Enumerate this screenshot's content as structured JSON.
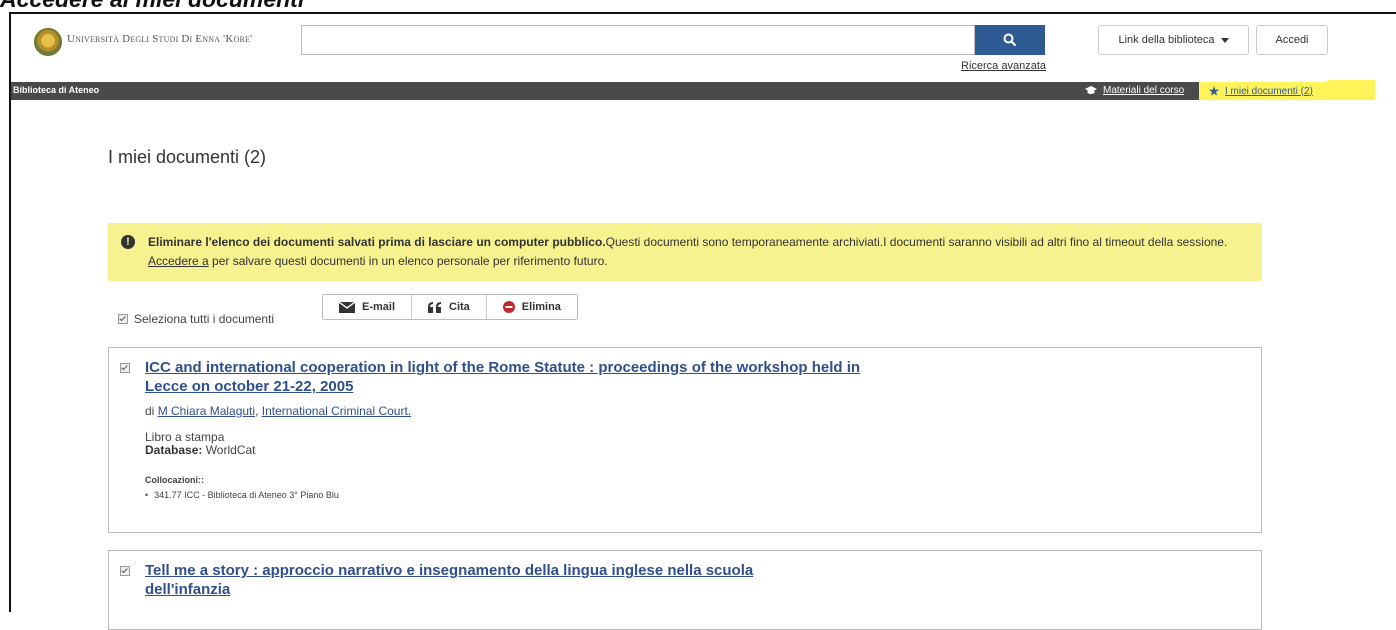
{
  "tutorial": {
    "heading": "Accedere ai miei documenti"
  },
  "header": {
    "logo_text": "Università Degli Studi Di Enna 'Kore'",
    "search_value": "",
    "advanced_search": "Ricerca avanzata",
    "library_links": "Link della biblioteca",
    "login": "Accedi"
  },
  "navbar": {
    "brand": "Biblioteca di Ateneo",
    "course_materials": "Materiali del corso",
    "my_documents": "I miei documenti (2)"
  },
  "main": {
    "title": "I miei documenti (2)",
    "alert": {
      "bold": "Eliminare l'elenco dei documenti salvati prima di lasciare un computer pubblico.",
      "text1": "Questi documenti sono temporaneamente archiviati.I documenti saranno visibili ad altri fino al timeout della sessione. ",
      "link": "Accedere a",
      "text2": " per salvare questi documenti in un elenco personale per riferimento futuro."
    },
    "select_all": "Seleziona tutti i documenti",
    "actions": {
      "email": "E-mail",
      "cite": "Cita",
      "delete": "Elimina"
    },
    "results": [
      {
        "title": "ICC and international cooperation in light of the Rome Statute : proceedings of the workshop held in Lecce on october 21-22, 2005",
        "author_prefix": "di ",
        "author1": "M Chiara Malaguti",
        "author_sep": ", ",
        "author2": "International Criminal Court.",
        "format": "Libro a stampa",
        "db_label": "Database:",
        "db_value": " WorldCat",
        "loc_label": "Collocazioni::",
        "loc_value": "341.77 ICC - Biblioteca di Ateneo 3° Piano Blu"
      },
      {
        "title": "Tell me a story : approccio narrativo e insegnamento della lingua inglese nella scuola dell'infanzia"
      }
    ]
  },
  "colors": {
    "accent": "#2f5b94",
    "highlight": "#fff35a",
    "alert_bg": "#f5f28f",
    "navbar_bg": "#4a4a4a"
  }
}
